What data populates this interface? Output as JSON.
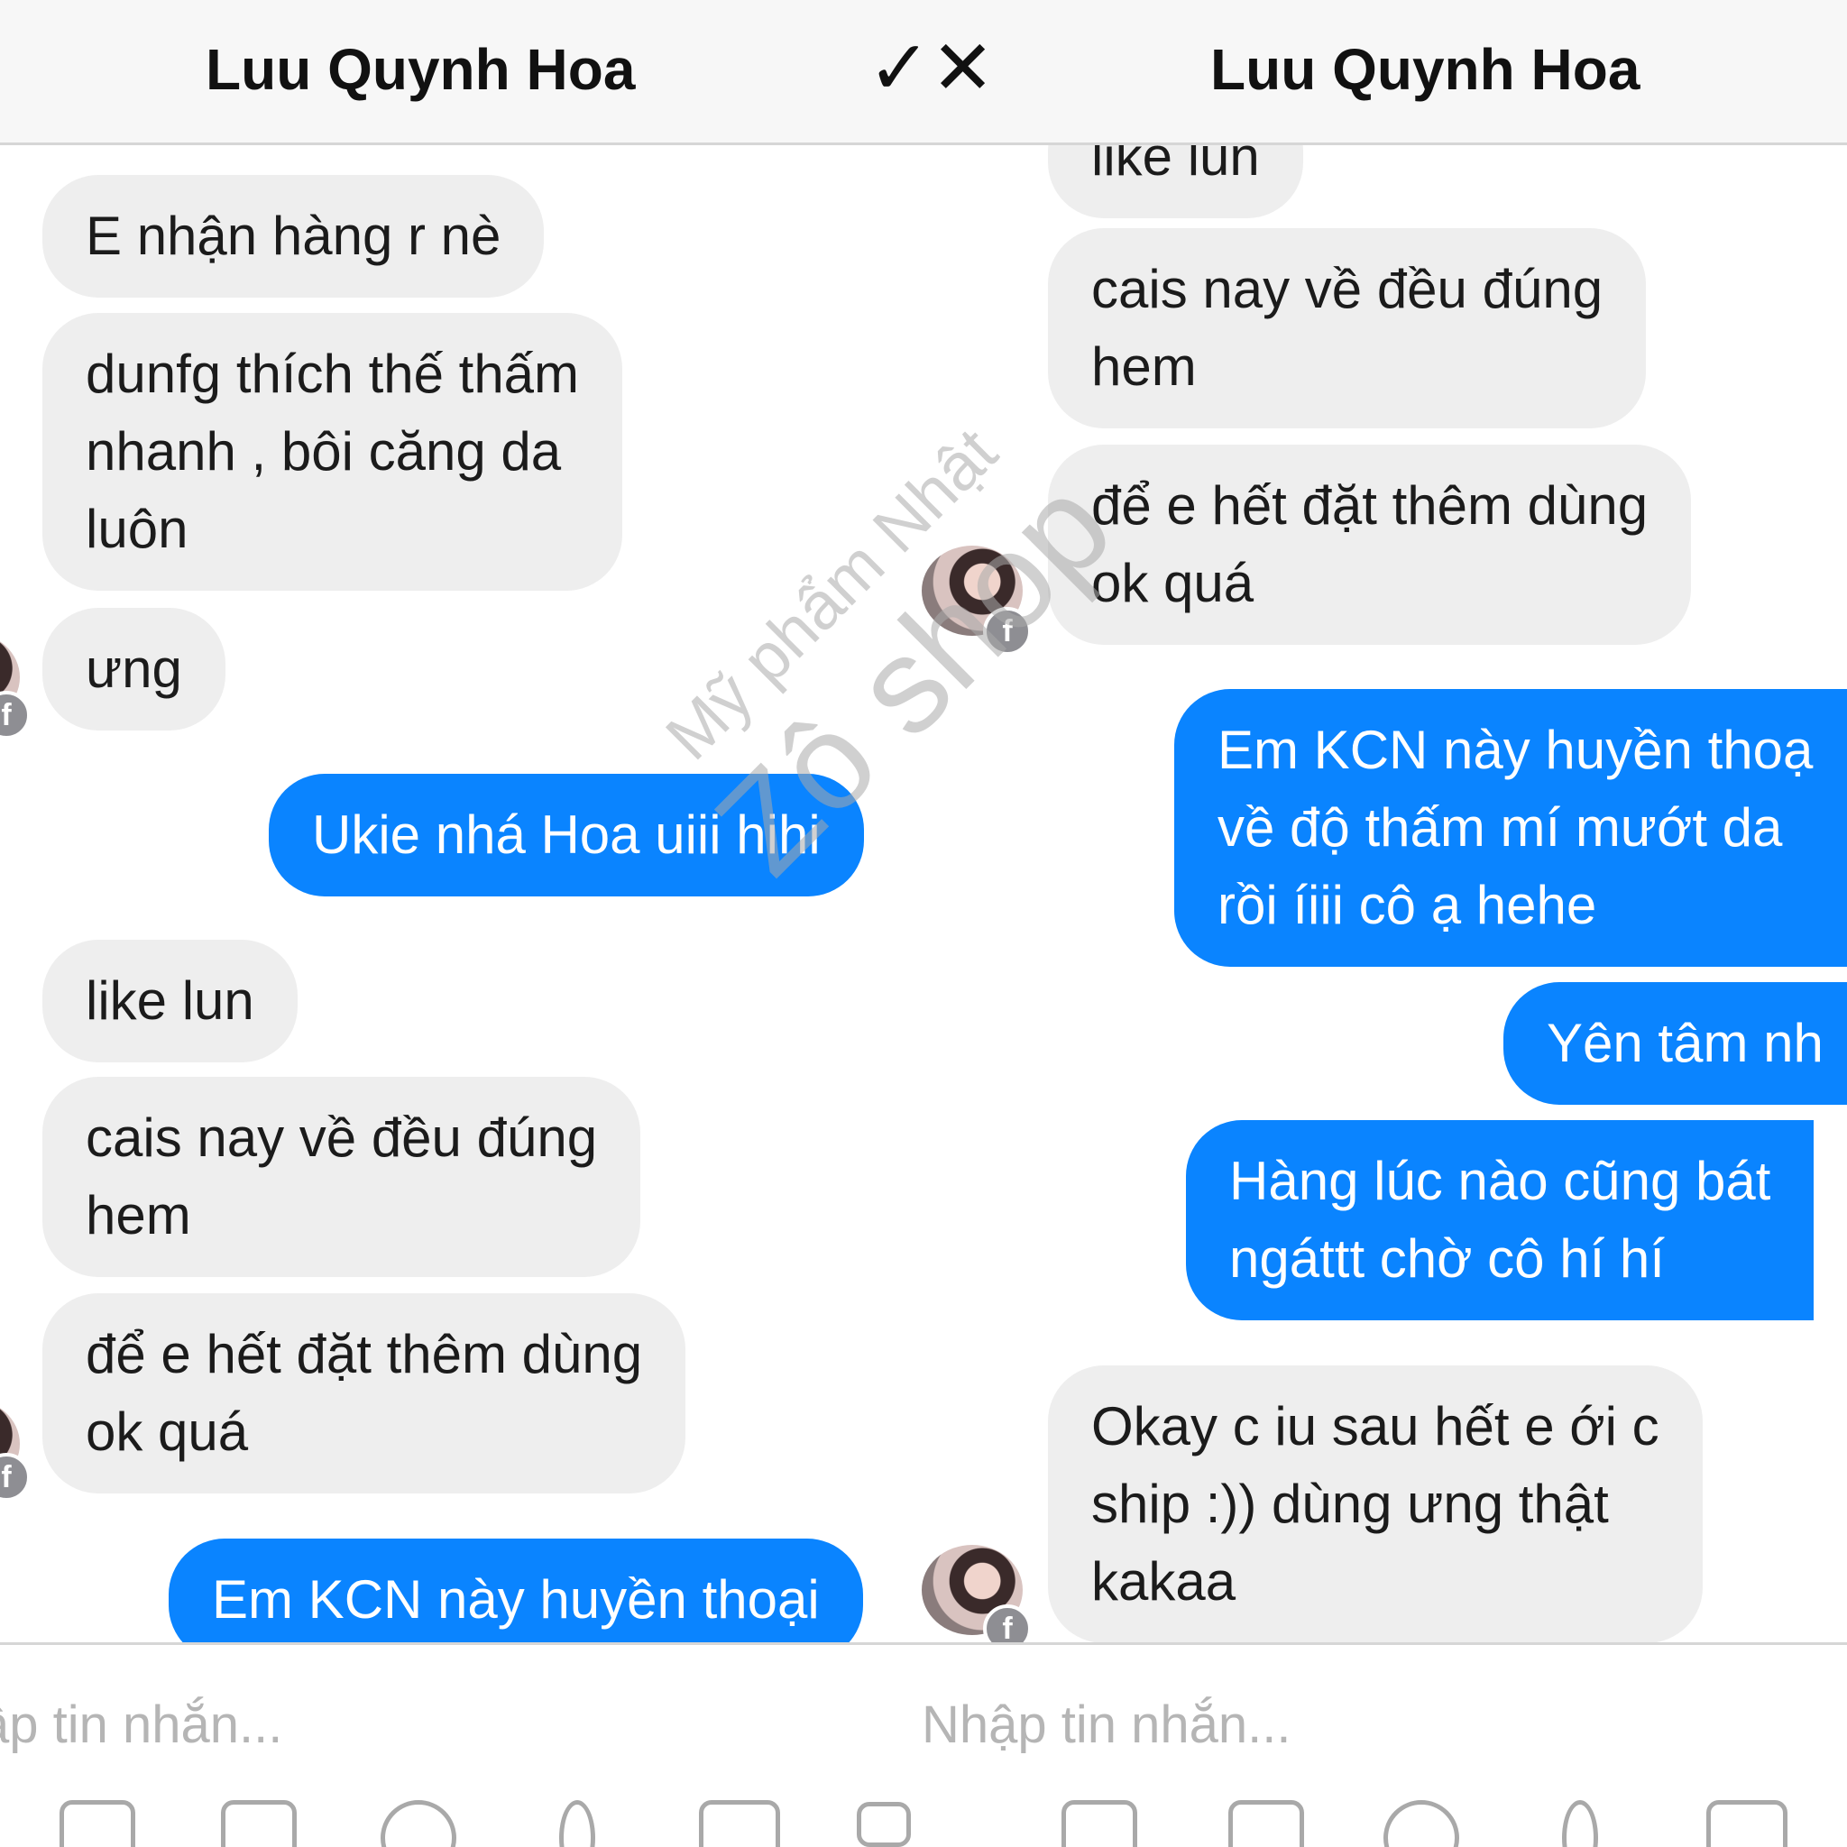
{
  "left_pane": {
    "contact_name": "Luu Quynh Hoa",
    "messages": [
      {
        "from": "contact",
        "text": "E nhận hàng r nè"
      },
      {
        "from": "contact",
        "lines": [
          "dunfg thích thế thấm",
          "nhanh , bôi căng da",
          "luôn"
        ]
      },
      {
        "from": "contact",
        "text": "ưng"
      },
      {
        "from": "me",
        "text": "Ukie nhá Hoa uiii hihi"
      },
      {
        "from": "contact",
        "text": "like lun"
      },
      {
        "from": "contact",
        "lines": [
          "cais nay về đều đúng",
          "hem"
        ]
      },
      {
        "from": "contact",
        "lines": [
          "để e hết đặt thêm dùng",
          "ok quá"
        ]
      },
      {
        "from": "me",
        "text": "Em KCN này huyền thoại"
      }
    ],
    "composer_placeholder": "ập tin nhắn..."
  },
  "right_pane": {
    "contact_name": "Luu Quynh Hoa",
    "messages": [
      {
        "from": "contact",
        "text": "like lun"
      },
      {
        "from": "contact",
        "lines": [
          "cais nay về đều đúng",
          "hem"
        ]
      },
      {
        "from": "contact",
        "lines": [
          "để e hết đặt thêm dùng",
          "ok quá"
        ]
      },
      {
        "from": "me",
        "lines": [
          "Em KCN này huyền thoạ",
          "về độ thấm mí mướt da",
          "rồi íiii cô ạ hehe"
        ]
      },
      {
        "from": "me",
        "text": "Yên tâm nh"
      },
      {
        "from": "me",
        "lines": [
          "Hàng lúc nào cũng bát",
          "ngáttt chờ cô hí hí"
        ]
      },
      {
        "from": "contact",
        "lines": [
          "Okay c iu sau hết e ới c",
          "ship :)) dùng ưng thật",
          "kakaa"
        ]
      }
    ],
    "composer_placeholder": "Nhập tin nhắn..."
  },
  "center_icon": "check-cross-icon",
  "colors": {
    "outgoing": "#0a84ff",
    "incoming": "#eeeeee",
    "header": "#f7f7f7"
  },
  "watermark": {
    "line1": "Mỹ phẩm Nhật",
    "line2": "Zô shop"
  },
  "composer_icons": [
    "camera-icon",
    "gallery-icon",
    "emoji-icon",
    "microphone-icon",
    "more-icon",
    "like-icon"
  ]
}
